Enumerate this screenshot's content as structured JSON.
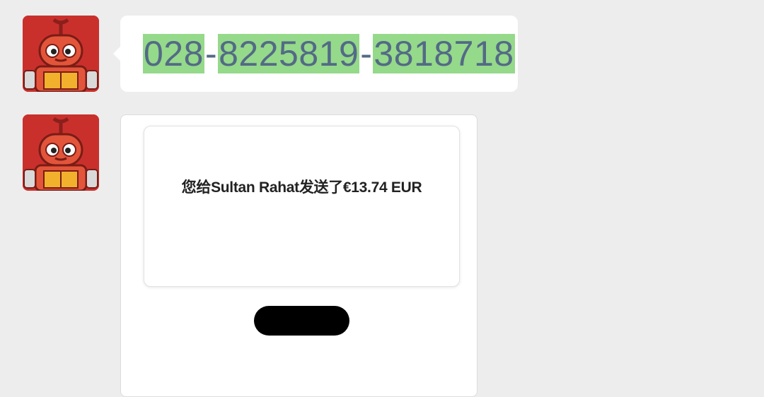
{
  "colors": {
    "background": "#ededed",
    "bubble": "#ffffff",
    "highlight": "#95d98a",
    "phone_text": "#536a86",
    "link": "#1a6fd6",
    "button": "#000000",
    "avatar_bg": "#c9302c"
  },
  "messages": [
    {
      "avatar_icon": "robot-avatar-icon",
      "type": "text",
      "phone": {
        "part1": "028",
        "sep1": "-",
        "part2": "8225819",
        "sep2": "-",
        "part3": "3818718"
      }
    },
    {
      "avatar_icon": "robot-avatar-icon",
      "type": "payment-card",
      "card": {
        "title": "您给Sultan Rahat发送了€13.74 EUR",
        "subtitle": "",
        "link": "",
        "button_label": "",
        "bottom_link": ""
      }
    }
  ]
}
